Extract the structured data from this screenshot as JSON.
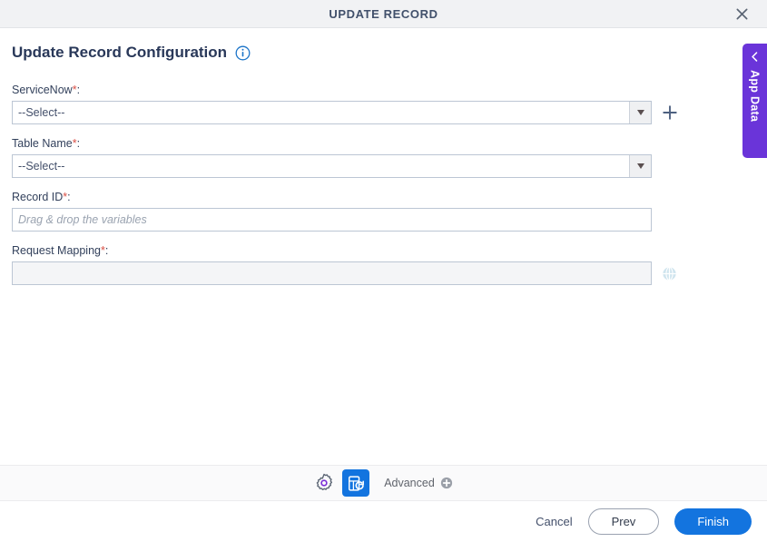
{
  "window": {
    "title": "UPDATE RECORD",
    "close_icon": "close-icon"
  },
  "heading": {
    "title": "Update Record Configuration",
    "info_icon": "info-icon"
  },
  "form": {
    "fields": [
      {
        "label": "ServiceNow",
        "required_mark": "*",
        "colon": ":",
        "type": "select",
        "value": "--Select--",
        "has_add_button": true,
        "add_icon": "plus-icon",
        "arrow_icon": "chevron-down-icon"
      },
      {
        "label": "Table Name",
        "required_mark": "*",
        "colon": ":",
        "type": "select",
        "value": "--Select--",
        "has_add_button": false,
        "arrow_icon": "chevron-down-icon"
      },
      {
        "label": "Record ID",
        "required_mark": "*",
        "colon": ":",
        "type": "text",
        "value": "",
        "placeholder": "Drag & drop the variables"
      },
      {
        "label": "Request Mapping",
        "required_mark": "*",
        "colon": ":",
        "type": "text-muted",
        "value": "",
        "placeholder": "",
        "trailing_icon": "globe-icon"
      }
    ]
  },
  "app_data_tab": {
    "label": "App Data",
    "chevron_icon": "chevron-left-icon",
    "color": "#6a34d9"
  },
  "toolbar": {
    "gear_icon": "gear-icon",
    "active_tool_icon": "form-refresh-icon",
    "advanced_label": "Advanced",
    "advanced_plus_icon": "plus-circle-icon",
    "active_color": "#1374df"
  },
  "footer": {
    "cancel_label": "Cancel",
    "prev_label": "Prev",
    "finish_label": "Finish",
    "primary_color": "#1374df"
  }
}
